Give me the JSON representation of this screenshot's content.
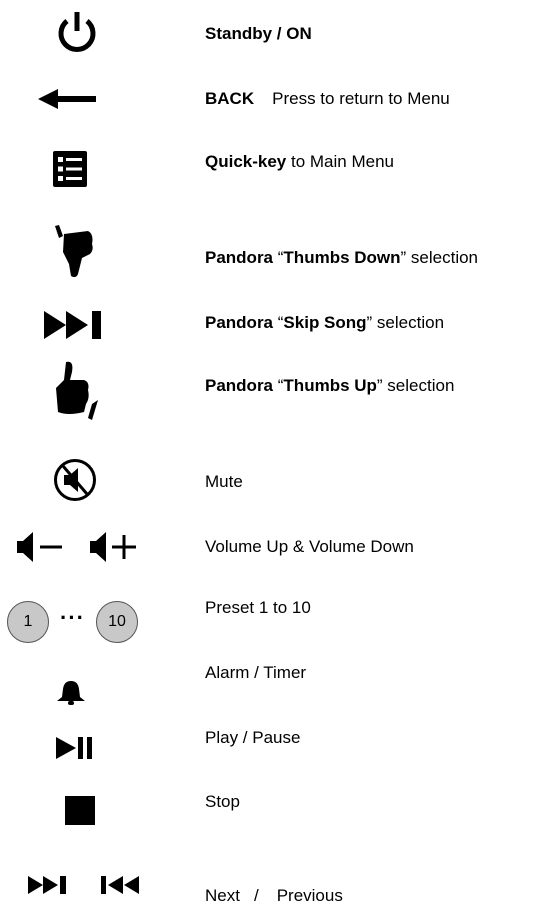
{
  "items": [
    {
      "icon": "power-icon",
      "parts": [
        {
          "text": "Standby / ON",
          "bold": true
        }
      ]
    },
    {
      "icon": "back-arrow-icon",
      "parts": [
        {
          "text": "BACK",
          "bold": true
        },
        {
          "text": "Press to return to Menu",
          "bold": false
        }
      ]
    },
    {
      "icon": "menu-list-icon",
      "parts": [
        {
          "text": "Quick-key",
          "bold": true
        },
        {
          "text": " to Main Menu",
          "bold": false
        }
      ]
    },
    {
      "icon": "thumbs-down-icon",
      "parts": [
        {
          "text": "Pandora",
          "bold": true
        },
        {
          "text": " “",
          "bold": false
        },
        {
          "text": "Thumbs Down",
          "bold": true
        },
        {
          "text": "” selection",
          "bold": false
        }
      ]
    },
    {
      "icon": "skip-icon",
      "parts": [
        {
          "text": "Pandora",
          "bold": true
        },
        {
          "text": " “",
          "bold": false
        },
        {
          "text": "Skip Song",
          "bold": true
        },
        {
          "text": "” selection",
          "bold": false
        }
      ]
    },
    {
      "icon": "thumbs-up-icon",
      "parts": [
        {
          "text": "Pandora",
          "bold": true
        },
        {
          "text": " “",
          "bold": false
        },
        {
          "text": "Thumbs Up",
          "bold": true
        },
        {
          "text": "” selection",
          "bold": false
        }
      ]
    },
    {
      "icon": "mute-icon",
      "parts": [
        {
          "text": "Mute",
          "bold": false
        }
      ]
    },
    {
      "icon": "volume-icons",
      "parts": [
        {
          "text": "Volume Up & Volume Down",
          "bold": false
        }
      ]
    },
    {
      "icon": "preset-icons",
      "parts": [
        {
          "text": "Preset 1 to 10",
          "bold": false
        }
      ]
    },
    {
      "icon": "bell-icon",
      "parts": [
        {
          "text": "Alarm / Timer",
          "bold": false
        }
      ]
    },
    {
      "icon": "play-pause-icon",
      "parts": [
        {
          "text": "Play / Pause",
          "bold": false
        }
      ]
    },
    {
      "icon": "stop-icon",
      "parts": [
        {
          "text": "Stop",
          "bold": false
        }
      ]
    },
    {
      "icon": "next-previous-icons",
      "parts": [
        {
          "text": "Next",
          "bold": false
        },
        {
          "text": "/",
          "bold": false
        },
        {
          "text": "Previous",
          "bold": false
        }
      ]
    }
  ],
  "preset": {
    "first": "1",
    "last": "10",
    "dots": "···"
  }
}
